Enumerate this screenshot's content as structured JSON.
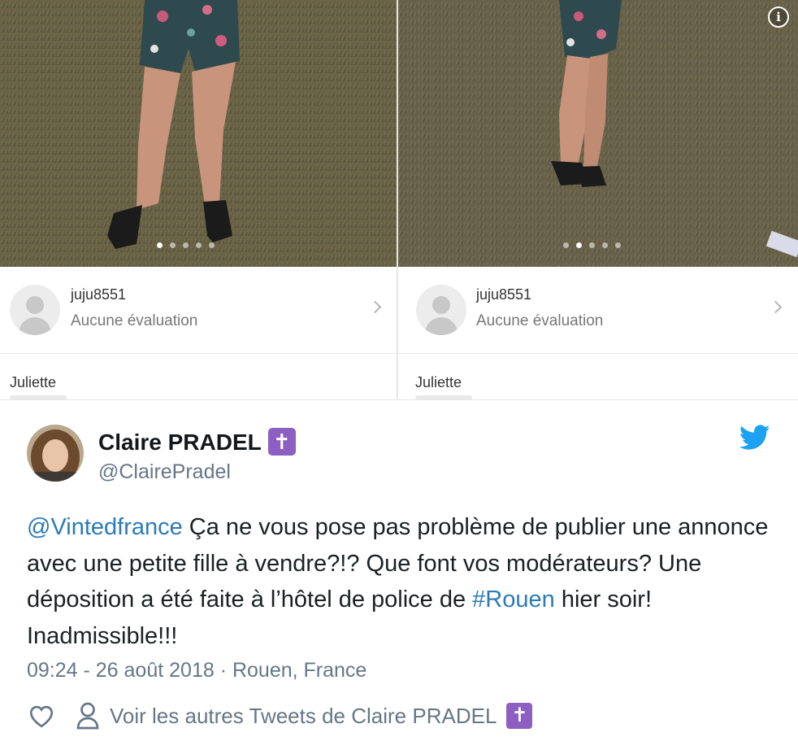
{
  "listings": [
    {
      "seller_name": "juju8551",
      "seller_rating": "Aucune évaluation",
      "description_title": "Juliette",
      "photo_count": 5,
      "active_photo": 1
    },
    {
      "seller_name": "juju8551",
      "seller_rating": "Aucune évaluation",
      "description_title": "Juliette",
      "photo_count": 5,
      "active_photo": 2
    }
  ],
  "tweet": {
    "author_name": "Claire PRADEL",
    "author_badge": "✝️",
    "handle": "@ClairePradel",
    "text_mention": "@Vintedfrance",
    "text_part1": " Ça ne vous pose pas problème de publier une annonce avec une petite fille à vendre?!? Que font vos modérateurs? Une déposition a été faite à l’hôtel de police de ",
    "text_hashtag": "#Rouen",
    "text_part2": " hier soir! Inadmissible!!!",
    "timestamp": "09:24 - 26 août 2018 · Rouen, France",
    "more_tweets_label": "Voir les autres Tweets de Claire PRADEL"
  },
  "colors": {
    "link": "#2b7bb9",
    "twitter_blue": "#1da1f2",
    "badge_purple": "#8e5fc3",
    "muted": "#657786"
  },
  "icons": [
    "info-icon",
    "chevron-right-icon",
    "twitter-bird-icon",
    "heart-icon",
    "person-icon",
    "latin-cross-icon"
  ]
}
